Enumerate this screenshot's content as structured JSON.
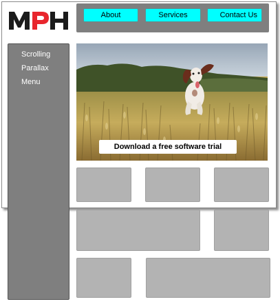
{
  "brand": {
    "logo_text": "MPH"
  },
  "topnav": {
    "items": [
      {
        "label": "About"
      },
      {
        "label": "Services"
      },
      {
        "label": "Contact Us"
      }
    ],
    "button_color": "#00ffff",
    "bar_color": "#7f7f7f"
  },
  "sidebar": {
    "items": [
      {
        "label": "Scrolling"
      },
      {
        "label": "Parallax"
      },
      {
        "label": "Menu"
      }
    ]
  },
  "hero": {
    "image": "dog running through wheat field",
    "cta_label": "Download a free software trial"
  },
  "cards": {
    "count": 7,
    "color": "#b3b3b3"
  }
}
